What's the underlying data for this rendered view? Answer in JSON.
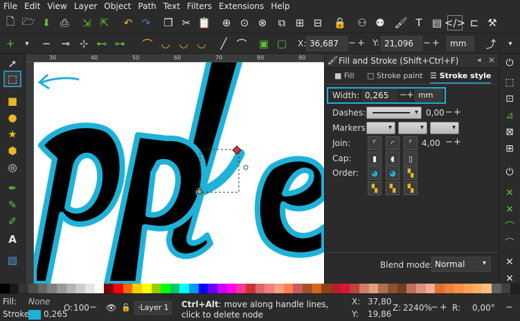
{
  "menu": [
    "File",
    "Edit",
    "View",
    "Layer",
    "Object",
    "Path",
    "Text",
    "Filters",
    "Extensions",
    "Help"
  ],
  "controls": {
    "x_label": "X:",
    "x_value": "36,687",
    "y_label": "Y:",
    "y_value": "21,096",
    "unit": "mm"
  },
  "ruler": {
    "ticks": [
      "30",
      "40",
      "50",
      "60",
      "70",
      "80",
      "90"
    ]
  },
  "dock": {
    "title": "Fill and Stroke (Shift+Ctrl+F)",
    "tabs": [
      {
        "label": "Fill",
        "icon": "square-icon"
      },
      {
        "label": "Stroke paint",
        "icon": "square-outline-icon"
      },
      {
        "label": "Stroke style",
        "icon": "dashes-icon"
      }
    ],
    "width_label": "Width:",
    "width_value": "0,265",
    "width_unit": "mm",
    "dashes_label": "Dashes:",
    "dashes_value": "0,00",
    "markers_label": "Markers:",
    "join_label": "Join:",
    "join_value": "4,00",
    "cap_label": "Cap:",
    "order_label": "Order:",
    "blend_label": "Blend mode:",
    "blend_value": "Normal"
  },
  "status": {
    "fill_label": "Fill:",
    "fill_value": "None",
    "stroke_label": "Stroke:",
    "stroke_value": "0,265",
    "stroke_color": "#1fb2d8",
    "opacity_label": "O:",
    "opacity_value": "100",
    "layer": "·Layer 1",
    "message_bold": "Ctrl+Alt",
    "message": ": move along handle lines, click to delete node",
    "x_label": "X:",
    "x_value": "37,80",
    "y_label": "Y:",
    "y_value": "19,86",
    "zoom_label": "Z:",
    "zoom_value": "2240%",
    "rot_label": "R:",
    "rot_value": "0,00°"
  },
  "palette": [
    "#000000",
    "#1a1a1a",
    "#333333",
    "#4d4d4d",
    "#666666",
    "#808080",
    "#999999",
    "#b3b3b3",
    "#cccccc",
    "#e6e6e6",
    "#ffffff",
    "#800000",
    "#ff0000",
    "#ff6600",
    "#ffcc00",
    "#ffff00",
    "#99cc00",
    "#00ff00",
    "#00cc66",
    "#00ffff",
    "#0099ff",
    "#0000ff",
    "#6600ff",
    "#cc00ff",
    "#ff00ff",
    "#ff3399",
    "#cc3333",
    "#e06666",
    "#f08080",
    "#ffa07a",
    "#ff7f50",
    "#cd5c5c",
    "#a0522d",
    "#d2691e",
    "#8b4513",
    "#b22222",
    "#dc143c",
    "#c04040",
    "#d08060",
    "#e0a080",
    "#b07050",
    "#905030",
    "#704020",
    "#c07060",
    "#e09080",
    "#f0b090",
    "#e07030",
    "#f08040",
    "#ff9040",
    "#ffa050",
    "#ffb060",
    "#ffc080",
    "#606060",
    "#404040",
    "#202020"
  ],
  "colors": {
    "accent": "#1fb2d8",
    "highlight": "#2a8fbd"
  }
}
